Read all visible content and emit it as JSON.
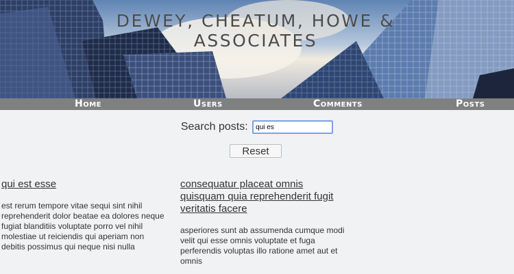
{
  "site": {
    "title": "Dewey, Cheatum, Howe & Associates"
  },
  "nav": {
    "items": [
      {
        "label": "Home",
        "name": "nav-home"
      },
      {
        "label": "Users",
        "name": "nav-users"
      },
      {
        "label": "Comments",
        "name": "nav-comments"
      },
      {
        "label": "Posts",
        "name": "nav-posts"
      }
    ]
  },
  "search": {
    "label": "Search posts:",
    "value": "qui es",
    "reset_label": "Reset"
  },
  "posts": [
    {
      "title": "qui est esse",
      "body": "est rerum tempore vitae sequi sint nihil reprehenderit dolor beatae ea dolores neque fugiat blanditiis voluptate porro vel nihil molestiae ut reiciendis qui aperiam non debitis possimus qui neque nisi nulla"
    },
    {
      "title": "consequatur placeat omnis quisquam quia reprehenderit fugit veritatis facere",
      "body": "asperiores sunt ab assumenda cumque modi velit qui esse omnis voluptate et fuga perferendis voluptas illo ratione amet aut et omnis"
    }
  ]
}
